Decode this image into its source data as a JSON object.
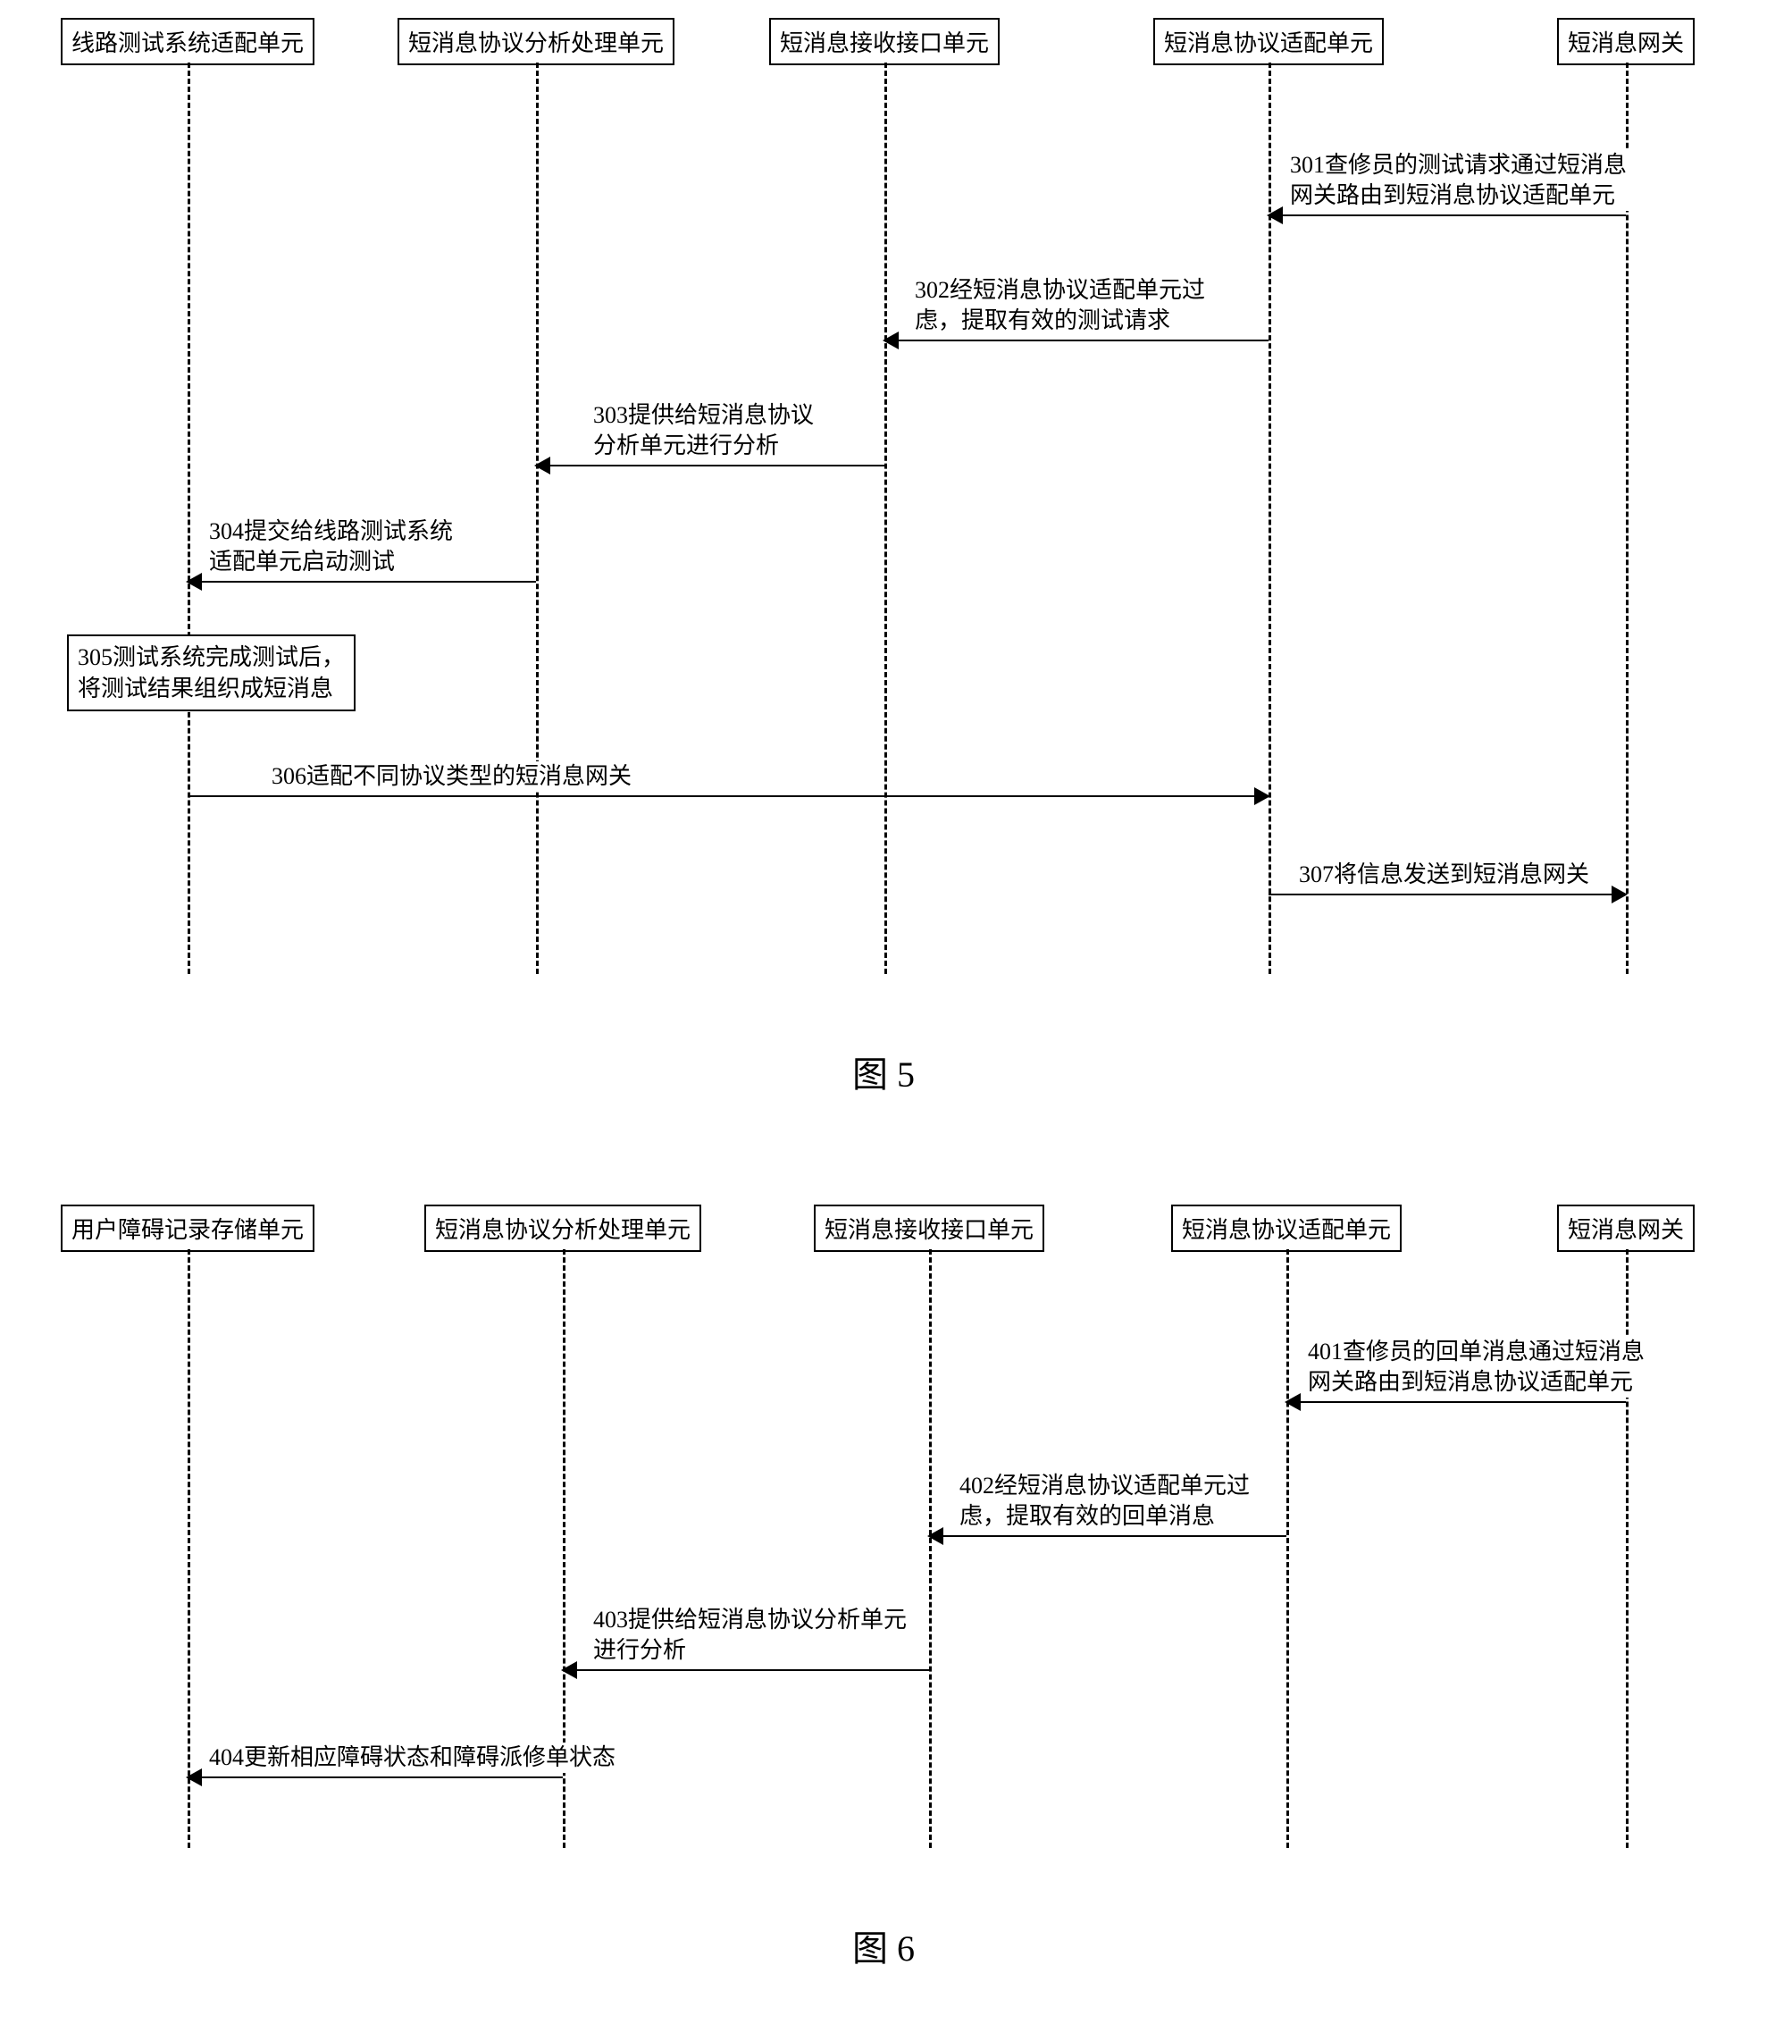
{
  "diagram1": {
    "actors": [
      "线路测试系统适配单元",
      "短消息协议分析处理单元",
      "短消息接收接口单元",
      "短消息协议适配单元",
      "短消息网关"
    ],
    "m301a": "301查修员的测试请求通过短消息",
    "m301b": "网关路由到短消息协议适配单元",
    "m302a": "302经短消息协议适配单元过",
    "m302b": "虑，提取有效的测试请求",
    "m303a": "303提供给短消息协议",
    "m303b": "分析单元进行分析",
    "m304a": "304提交给线路测试系统",
    "m304b": "适配单元启动测试",
    "m305a": "305测试系统完成测试后，",
    "m305b": "将测试结果组织成短消息",
    "m306": "306适配不同协议类型的短消息网关",
    "m307": "307将信息发送到短消息网关",
    "caption": "图 5"
  },
  "diagram2": {
    "actors": [
      "用户障碍记录存储单元",
      "短消息协议分析处理单元",
      "短消息接收接口单元",
      "短消息协议适配单元",
      "短消息网关"
    ],
    "m401a": "401查修员的回单消息通过短消息",
    "m401b": "网关路由到短消息协议适配单元",
    "m402a": "402经短消息协议适配单元过",
    "m402b": "虑，提取有效的回单消息",
    "m403a": "403提供给短消息协议分析单元",
    "m403b": "进行分析",
    "m404": "404更新相应障碍状态和障碍派修单状态",
    "caption": "图 6"
  }
}
